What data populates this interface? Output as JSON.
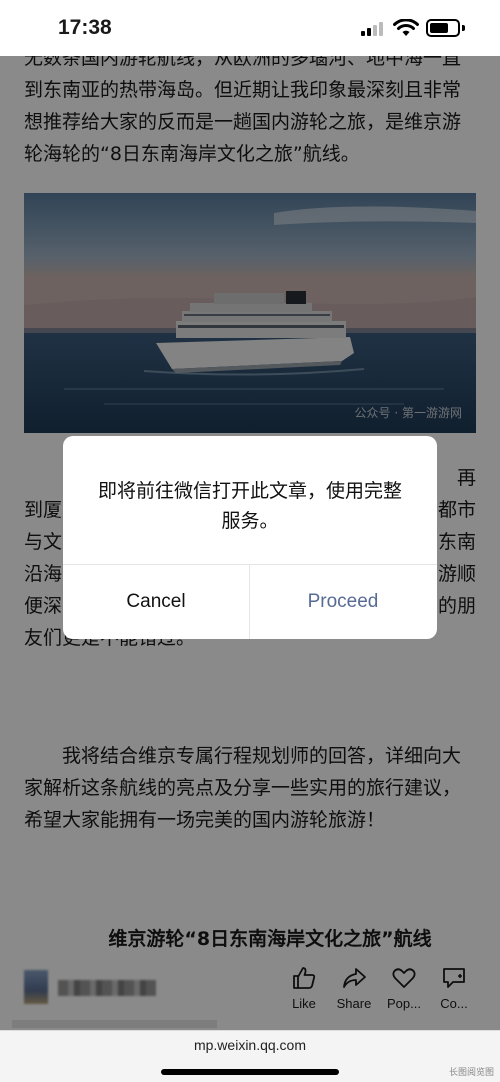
{
  "status_bar": {
    "time": "17:38",
    "battery_level": 0.7
  },
  "article": {
    "para1": "无数条国内游轮航线，从欧洲的多瑙河、地中海一直到东南亚的热带海岛。但近期让我印象最深刻且非常想推荐给大家的反而是一趟国内游轮之旅，是维京游轮海轮的“8日东南海岸文化之旅”航线。",
    "photo_watermark": "公众号 · 第一游游网",
    "para2": "再到厦门……都市与文……东南沿海……游顺便深……的朋友们更是不能错过。",
    "para2_visible_start": "再",
    "para2_visible_lines": [
      "到厦",
      "与文",
      "沿海",
      "便深",
      "友们更是不能错过。"
    ],
    "para2_right_fragments": [
      "都市",
      "东南",
      "游顺",
      "的朋"
    ],
    "para3": "我将结合维京专属行程规划师的回答，详细向大家解析这条航线的亮点及分享一些实用的旅行建议，希望大家能拥有一场完美的国内游轮旅游！",
    "section_title": "维京游轮“8日东南海岸文化之旅”航线"
  },
  "toolbar": {
    "like_label": "Like",
    "share_label": "Share",
    "popular_label": "Pop...",
    "comment_label": "Co..."
  },
  "url_bar": {
    "url": "mp.weixin.qq.com",
    "corner_mark": "长图阅览图"
  },
  "dialog": {
    "message": "即将前往微信打开此文章，使用完整服务。",
    "cancel_label": "Cancel",
    "proceed_label": "Proceed"
  },
  "colors": {
    "proceed": "#576b95",
    "overlay": "rgba(0,0,0,0.46)"
  },
  "icons": [
    "signal-icon",
    "wifi-icon",
    "battery-icon",
    "thumbs-up-icon",
    "share-arrow-icon",
    "heart-icon",
    "comment-icon"
  ]
}
